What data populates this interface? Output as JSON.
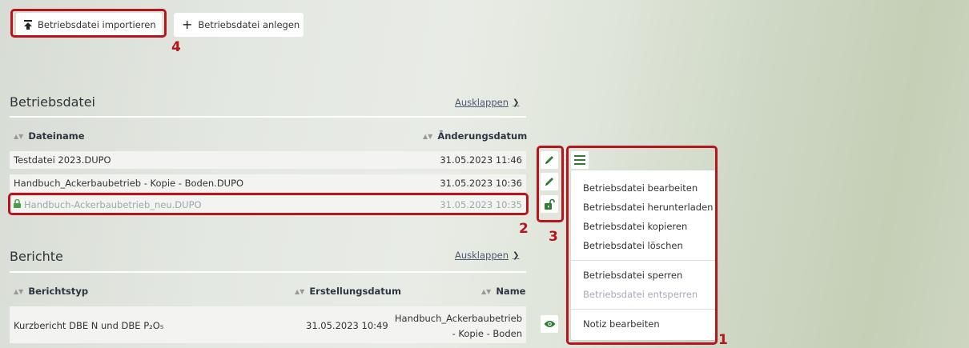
{
  "toolbar": {
    "import_label": "Betriebsdatei importieren",
    "create_label": "Betriebsdatei anlegen"
  },
  "annotations": {
    "n1": "1",
    "n2": "2",
    "n3": "3",
    "n4": "4"
  },
  "betriebsdatei": {
    "title": "Betriebsdatei",
    "expand_label": "Ausklappen",
    "columns": {
      "filename": "Dateiname",
      "changed": "Änderungsdatum"
    },
    "rows": [
      {
        "name": "Testdatei 2023.DUPO",
        "date": "31.05.2023 11:46"
      },
      {
        "name": "Handbuch_Ackerbaubetrieb - Kopie - Boden.DUPO",
        "date": "31.05.2023 10:36"
      },
      {
        "name": "Handbuch-Ackerbaubetrieb_neu.DUPO",
        "date": "31.05.2023 10:35"
      }
    ]
  },
  "berichte": {
    "title": "Berichte",
    "expand_label": "Ausklappen",
    "columns": {
      "type": "Berichtstyp",
      "created": "Erstellungsdatum",
      "name": "Name"
    },
    "rows": [
      {
        "type": "Kurzbericht DBE N und DBE P₂O₅",
        "created": "31.05.2023 10:49",
        "name_line1": "Handbuch_Ackerbaubetrieb",
        "name_line2": "- Kopie - Boden"
      }
    ]
  },
  "context_menu": {
    "items": [
      "Betriebsdatei bearbeiten",
      "Betriebsdatei herunterladen",
      "Betriebsdatei kopieren",
      "Betriebsdatei löschen"
    ],
    "lock_items": [
      {
        "label": "Betriebsdatei sperren",
        "disabled": false
      },
      {
        "label": "Betriebsdatei entsperren",
        "disabled": true
      }
    ],
    "note_label": "Notiz bearbeiten"
  },
  "colors": {
    "annotation_red": "#b5161d",
    "accent_green": "#4c9e49"
  }
}
